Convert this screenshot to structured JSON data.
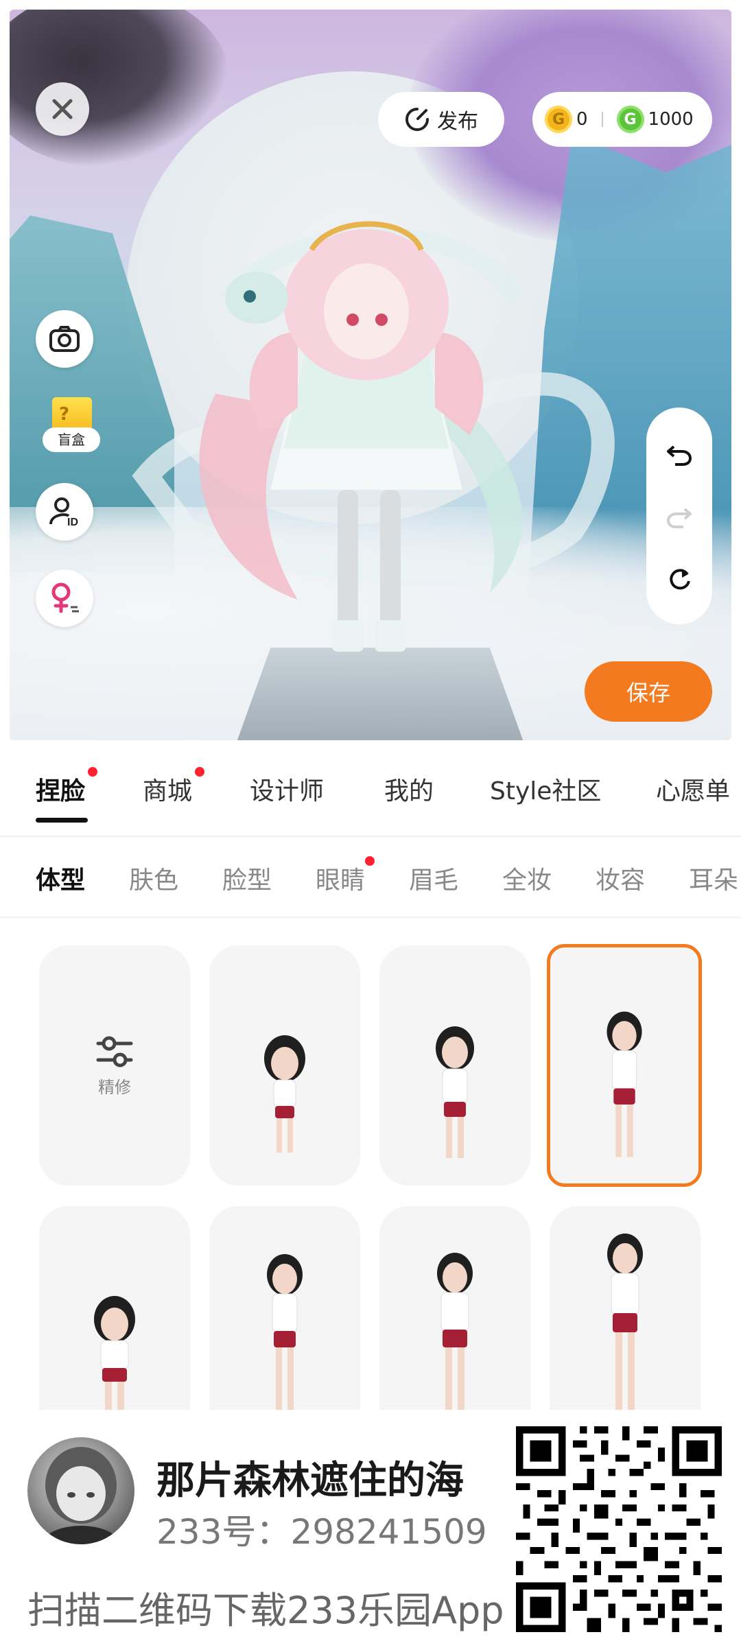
{
  "topbar": {
    "publish_label": "发布",
    "gold_count": "0",
    "green_count": "1000"
  },
  "left_tools": {
    "blind_box_label": "盲盒"
  },
  "save_label": "保存",
  "main_tabs": [
    {
      "label": "捏脸",
      "active": true,
      "dot": true
    },
    {
      "label": "商城",
      "active": false,
      "dot": true
    },
    {
      "label": "设计师",
      "active": false,
      "dot": false
    },
    {
      "label": "我的",
      "active": false,
      "dot": false
    },
    {
      "label": "Style社区",
      "active": false,
      "dot": false
    },
    {
      "label": "心愿单",
      "active": false,
      "dot": false
    }
  ],
  "sub_tabs": [
    {
      "label": "体型",
      "active": true
    },
    {
      "label": "肤色"
    },
    {
      "label": "脸型"
    },
    {
      "label": "眼睛",
      "dot": true
    },
    {
      "label": "眉毛"
    },
    {
      "label": "全妆"
    },
    {
      "label": "妆容"
    },
    {
      "label": "耳朵"
    }
  ],
  "grid": {
    "refine_label": "精修",
    "selected_index": 3
  },
  "footer": {
    "username": "那片森林遮住的海",
    "user_id": "233号：298241509",
    "scan_text": "扫描二维码下载233乐园App"
  },
  "colors": {
    "accent": "#f47a1f",
    "dot": "#ff2030"
  }
}
